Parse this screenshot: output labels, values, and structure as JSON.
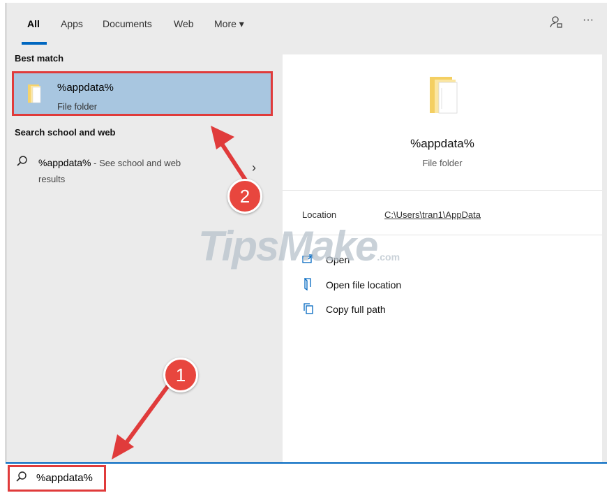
{
  "tabs": [
    "All",
    "Apps",
    "Documents",
    "Web",
    "More ▾"
  ],
  "top_icons": {
    "feedback": "feedback-icon",
    "more": "···"
  },
  "best_match": {
    "header": "Best match",
    "title": "%appdata%",
    "subtitle": "File folder"
  },
  "web": {
    "header": "Search school and web",
    "query": "%appdata%",
    "suffix": " - See school and web",
    "suffix2": "results"
  },
  "preview": {
    "title": "%appdata%",
    "subtitle": "File folder",
    "location_label": "Location",
    "location_value": "C:\\Users\\tran1\\AppData",
    "actions": [
      {
        "label": "Open",
        "icon": "open-icon"
      },
      {
        "label": "Open file location",
        "icon": "file-location-icon"
      },
      {
        "label": "Copy full path",
        "icon": "copy-path-icon"
      }
    ]
  },
  "search": {
    "value": "%appdata%"
  },
  "watermark": {
    "brand": "TipsMake",
    "domain": ".com"
  },
  "badges": [
    "1",
    "2"
  ],
  "colors": {
    "accent": "#0067c0",
    "highlight": "#a8c6e0",
    "annotation": "#e03b3b"
  }
}
